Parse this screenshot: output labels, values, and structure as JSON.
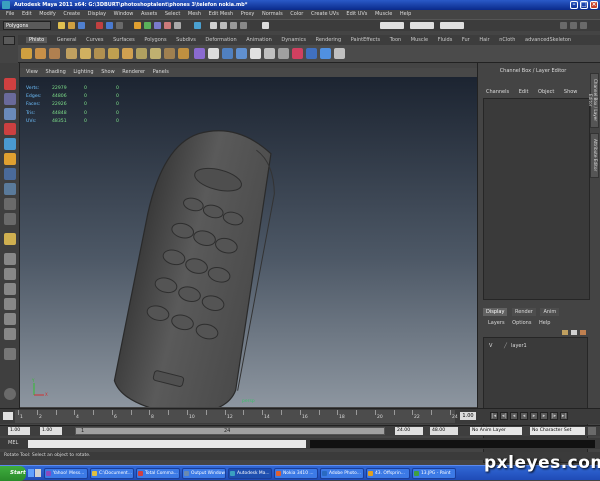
{
  "window": {
    "title": "Autodesk Maya 2011 x64: G:\\3DBURT\\photoshoptalent\\phones 3\\telefon nokia.mb*"
  },
  "menubar": [
    "File",
    "Edit",
    "Modify",
    "Create",
    "Display",
    "Window",
    "Assets",
    "Select",
    "Mesh",
    "Edit Mesh",
    "Proxy",
    "Normals",
    "Color",
    "Create UVs",
    "Edit UVs",
    "Muscle",
    "Help"
  ],
  "status_line": {
    "mode": "Polygons"
  },
  "shelf_tabs": [
    "Phisto",
    "General",
    "Curves",
    "Surfaces",
    "Polygons",
    "Subdivs",
    "Deformation",
    "Animation",
    "Dynamics",
    "Rendering",
    "PaintEffects",
    "Toon",
    "Muscle",
    "Fluids",
    "Fur",
    "Hair",
    "nCloth",
    "advancedSkeleton"
  ],
  "panel_menu": [
    "View",
    "Shading",
    "Lighting",
    "Show",
    "Renderer",
    "Panels"
  ],
  "hud": [
    {
      "label": "Verts:",
      "value": "22979",
      "c1": "0",
      "c2": "0"
    },
    {
      "label": "Edges:",
      "value": "44806",
      "c1": "0",
      "c2": "0"
    },
    {
      "label": "Faces:",
      "value": "22926",
      "c1": "0",
      "c2": "0"
    },
    {
      "label": "Tris:",
      "value": "44848",
      "c1": "0",
      "c2": "0"
    },
    {
      "label": "UVs:",
      "value": "48351",
      "c1": "0",
      "c2": "0"
    }
  ],
  "viewport": {
    "camera_label": "persp"
  },
  "channel_box": {
    "header": "Channel Box / Layer Editor",
    "menu": [
      "Channels",
      "Edit",
      "Object",
      "Show"
    ],
    "side_tabs": [
      "Channel Box / Layer Editor",
      "Attribute Editor"
    ],
    "layer_tabs": [
      "Display",
      "Render",
      "Anim"
    ],
    "layer_menu": [
      "Layers",
      "Options",
      "Help"
    ],
    "layer": {
      "visible": "V",
      "name": "layer1"
    }
  },
  "timeline": {
    "tick_labels": [
      "1",
      "2",
      "4",
      "6",
      "8",
      "10",
      "12",
      "14",
      "16",
      "18",
      "20",
      "22",
      "24"
    ],
    "current_frame": "1.00"
  },
  "range": {
    "start": "1.00",
    "inner_start": "1.00",
    "slider_value": "1",
    "slider_end": "24",
    "end": "24.00",
    "total": "48.00",
    "anim_layer": "No Anim Layer",
    "char_set": "No Character Set"
  },
  "mel": {
    "label": "MEL"
  },
  "help_line": "Rotate Tool: Select an object to rotate.",
  "taskbar": {
    "start": "Start",
    "items": [
      {
        "label": "Yahoo! Mess...",
        "color": "#8a4ac0"
      },
      {
        "label": "C:\\Document...",
        "color": "#e0c040"
      },
      {
        "label": "Total Comma...",
        "color": "#d04040"
      },
      {
        "label": "Output Window",
        "color": "#6a8ab0"
      },
      {
        "label": "Autodesk Ma...",
        "color": "#3aa0c0",
        "active": true
      },
      {
        "label": "Nokia 3410 ...",
        "color": "#e06030"
      },
      {
        "label": "Adobe Photo...",
        "color": "#2a6ac0"
      },
      {
        "label": "43. Offsprin...",
        "color": "#e0a020"
      },
      {
        "label": "13.JPG - Paint",
        "color": "#40a040"
      }
    ]
  },
  "watermark": "pxleyes.com"
}
